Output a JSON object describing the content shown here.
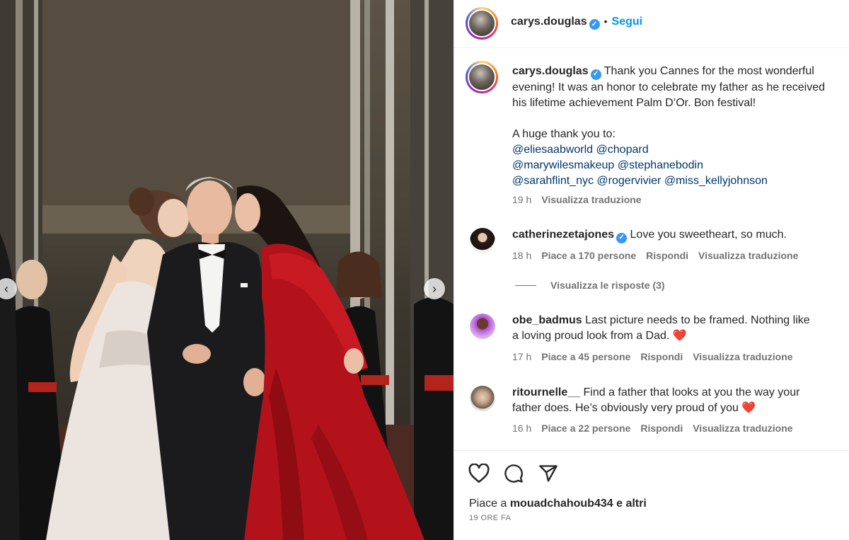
{
  "post": {
    "username": "carys.douglas",
    "follow_label": "Segui",
    "caption_line1": "Thank you Cannes for the most wonderful",
    "caption_line2": "evening! It was an honor to celebrate my father as he received",
    "caption_line3": "his lifetime achievement Palm D’Or. Bon festival!",
    "thanks_heading": "A huge thank you to:",
    "mentions_line1": [
      "@eliesaabworld",
      "@chopard"
    ],
    "mentions_line2": [
      "@marywilesmakeup",
      "@stephanebodin"
    ],
    "mentions_line3": [
      "@sarahflint_nyc",
      "@rogervivier",
      "@miss_kellyjohnson"
    ],
    "time": "19 h",
    "translate_label": "Visualizza traduzione"
  },
  "comments": [
    {
      "username": "catherinezetajones",
      "verified": true,
      "text": "Love you sweetheart, so much.",
      "time": "18 h",
      "likes": "Piace a 170 persone",
      "reply": "Rispondi",
      "translate": "Visualizza traduzione",
      "view_replies": "Visualizza le risposte (3)"
    },
    {
      "username": "obe_badmus",
      "text_line1": "Last picture needs to be framed. Nothing like",
      "text_line2": "a loving proud look from a Dad.",
      "emoji": "❤️",
      "time": "17 h",
      "likes": "Piace a 45 persone",
      "reply": "Rispondi",
      "translate": "Visualizza traduzione"
    },
    {
      "username": "ritournelle__",
      "text_line1": "Find a father that looks at you the way your",
      "text_line2": "father does. He’s obviously very proud of you",
      "emoji": "❤️",
      "time": "16 h",
      "likes": "Piace a 22 persone",
      "reply": "Rispondi",
      "translate": "Visualizza traduzione"
    }
  ],
  "footer": {
    "likes_prefix": "Piace a",
    "likes_user": "mouadchahoub434",
    "likes_suffix": "e altri",
    "posted_ago": "19 ORE FA"
  },
  "icons": {
    "like": "heart-icon",
    "comment": "comment-icon",
    "share": "share-icon",
    "verified": "verified-badge-icon",
    "carousel_prev": "chevron-left-icon",
    "carousel_next": "chevron-right-icon"
  },
  "colors": {
    "link": "#0095f6",
    "mention": "#00376b",
    "muted": "#737373",
    "dress_red": "#b3121b"
  }
}
